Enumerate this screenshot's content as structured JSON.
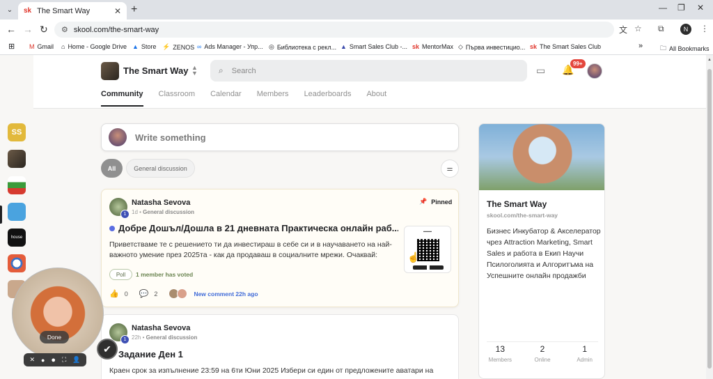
{
  "browser": {
    "tab_title": "The Smart Way",
    "tab_favicon": "sk",
    "url": "skool.com/the-smart-way",
    "profile_letter": "N",
    "bookmarks": [
      {
        "icon": "M",
        "label": "Gmail"
      },
      {
        "icon": "⌂",
        "label": "Home - Google Drive"
      },
      {
        "icon": "▲",
        "label": "Store"
      },
      {
        "icon": "⚡",
        "label": "ZENOS"
      },
      {
        "icon": "∞",
        "label": "Ads Manager - Упр..."
      },
      {
        "icon": "◎",
        "label": "Библиотека с рекл..."
      },
      {
        "icon": "▲",
        "label": "Smart Sales Club -..."
      },
      {
        "icon": "sk",
        "label": "MentorMax"
      },
      {
        "icon": "◇",
        "label": "Първа инвестицио..."
      },
      {
        "icon": "sk",
        "label": "The Smart Sales Club"
      }
    ],
    "all_bookmarks": "All Bookmarks"
  },
  "header": {
    "group_name": "The Smart Way",
    "search_placeholder": "Search",
    "notification_count": "99+",
    "tabs": [
      {
        "label": "Community"
      },
      {
        "label": "Classroom"
      },
      {
        "label": "Calendar"
      },
      {
        "label": "Members"
      },
      {
        "label": "Leaderboards"
      },
      {
        "label": "About"
      }
    ]
  },
  "rail": {
    "items": [
      {
        "label": "SS",
        "color": "#e2b93b"
      }
    ]
  },
  "composer": {
    "placeholder": "Write something"
  },
  "filters": {
    "all": "All",
    "category": "General discussion"
  },
  "posts": [
    {
      "author": "Natasha Sevova",
      "level": "1",
      "time": "1d",
      "category": "General discussion",
      "pinned_label": "Pinned",
      "title": "Добре Дошъл/Дошла в 21 дневната Практическа онлайн раб...",
      "body": "Приветстваме те с решението ти да инвестираш в себе си и в научаването на най-важното умение през 2025та - как да продаваш в социалните мрежи. Очаквай:",
      "poll": "Poll",
      "voted": "1 member has voted",
      "likes": "0",
      "comments": "2",
      "new_comment": "New comment 22h ago"
    },
    {
      "author": "Natasha Sevova",
      "level": "1",
      "time": "22h",
      "category": "General discussion",
      "title": "Задание Ден 1",
      "body": "Краен срок за изпълнение 23:59 на 6ти Юни 2025 Избери си един от предложените аватари на"
    }
  ],
  "sidebar": {
    "name": "The Smart Way",
    "url": "skool.com/the-smart-way",
    "description": "Бизнес Инкубатор & Акселератор чрез Attraction Marketing, Smart Sales и работа в Екип Научи Псилоголията и Алгоритъма на Успешните онлайн продажби",
    "stats": [
      {
        "value": "13",
        "label": "Members"
      },
      {
        "value": "2",
        "label": "Online"
      },
      {
        "value": "1",
        "label": "Admin"
      }
    ]
  },
  "webcam": {
    "done_label": "Done"
  }
}
